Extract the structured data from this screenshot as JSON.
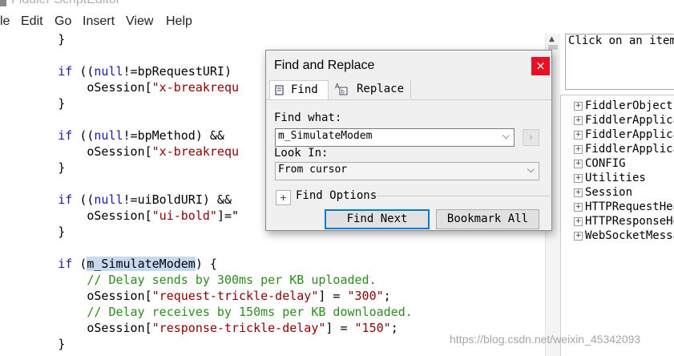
{
  "window": {
    "title": "Fiddler ScriptEditor"
  },
  "menu": [
    "le",
    "Edit",
    "Go",
    "Insert",
    "View",
    "Help"
  ],
  "code": [
    [
      {
        "t": "        }"
      }
    ],
    [],
    [
      {
        "t": "        "
      },
      {
        "t": "if",
        "c": "kw"
      },
      {
        "t": " (("
      },
      {
        "t": "null",
        "c": "kw"
      },
      {
        "t": "!=bpRequestURI)"
      }
    ],
    [
      {
        "t": "            oSession["
      },
      {
        "t": "\"x-breakrequ",
        "c": "str"
      }
    ],
    [
      {
        "t": "        }"
      }
    ],
    [],
    [
      {
        "t": "        "
      },
      {
        "t": "if",
        "c": "kw"
      },
      {
        "t": " (("
      },
      {
        "t": "null",
        "c": "kw"
      },
      {
        "t": "!=bpMethod) && "
      }
    ],
    [
      {
        "t": "            oSession["
      },
      {
        "t": "\"x-breakrequ",
        "c": "str"
      }
    ],
    [
      {
        "t": "        }"
      }
    ],
    [],
    [
      {
        "t": "        "
      },
      {
        "t": "if",
        "c": "kw"
      },
      {
        "t": " (("
      },
      {
        "t": "null",
        "c": "kw"
      },
      {
        "t": "!=uiBoldURI) &&"
      }
    ],
    [
      {
        "t": "            oSession["
      },
      {
        "t": "\"ui-bold\"",
        "c": "str"
      },
      {
        "t": "]=\""
      }
    ],
    [
      {
        "t": "        }"
      }
    ],
    [],
    [
      {
        "t": "        "
      },
      {
        "t": "if",
        "c": "kw"
      },
      {
        "t": " ("
      },
      {
        "t": "m_SimulateModem",
        "c": "hl"
      },
      {
        "t": ") {"
      }
    ],
    [
      {
        "t": "            "
      },
      {
        "t": "// Delay sends by 300ms per KB uploaded.",
        "c": "cm"
      }
    ],
    [
      {
        "t": "            oSession["
      },
      {
        "t": "\"request-trickle-delay\"",
        "c": "str"
      },
      {
        "t": "] = "
      },
      {
        "t": "\"300\"",
        "c": "str"
      },
      {
        "t": ";"
      }
    ],
    [
      {
        "t": "            "
      },
      {
        "t": "// Delay receives by 150ms per KB downloaded.",
        "c": "cm"
      }
    ],
    [
      {
        "t": "            oSession["
      },
      {
        "t": "\"response-trickle-delay\"",
        "c": "str"
      },
      {
        "t": "] = "
      },
      {
        "t": "\"150\"",
        "c": "str"
      },
      {
        "t": ";"
      }
    ],
    [
      {
        "t": "        }"
      }
    ]
  ],
  "reference": {
    "hint": "Click on an item",
    "tree": [
      "FiddlerObject",
      "FiddlerApplica",
      "FiddlerApplica",
      "FiddlerApplica",
      "CONFIG",
      "Utilities",
      "Session",
      "HTTPRequestHea",
      "HTTPResponseHe",
      "WebSocketMessa"
    ]
  },
  "dialog": {
    "title": "Find and Replace",
    "close_glyph": "×",
    "tabs": {
      "find": {
        "label": "Find",
        "icon": "find-icon"
      },
      "replace": {
        "label": "Replace",
        "icon": "replace-icon"
      }
    },
    "find_what_label": "Find what:",
    "find_what_value": "m_SimulateModem",
    "look_in_label": "Look In:",
    "look_in_value": "From cursor",
    "find_options_label": "Find Options",
    "find_next_label": "Find Next",
    "bookmark_all_label": "Bookmark All"
  },
  "watermark": "https://blog.csdn.net/weixin_45342093",
  "colors": {
    "keyword": "#1a1aa6",
    "string": "#8b0000",
    "comment": "#2e8b20",
    "highlight": "#c6d9ee",
    "close": "#e81123",
    "default_button_border": "#0078d7"
  }
}
